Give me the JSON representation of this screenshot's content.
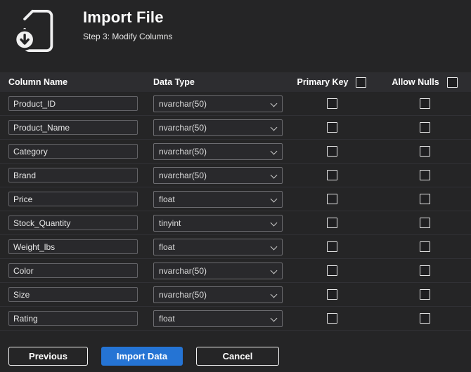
{
  "header": {
    "title": "Import File",
    "subtitle": "Step 3: Modify Columns",
    "icon": "file-download-icon"
  },
  "table": {
    "headers": {
      "column_name": "Column Name",
      "data_type": "Data Type",
      "primary_key": "Primary Key",
      "allow_nulls": "Allow Nulls"
    },
    "select_all": {
      "primary_key_checked": false,
      "allow_nulls_checked": false
    },
    "rows": [
      {
        "name": "Product_ID",
        "type": "nvarchar(50)",
        "primary_key": false,
        "allow_nulls": false
      },
      {
        "name": "Product_Name",
        "type": "nvarchar(50)",
        "primary_key": false,
        "allow_nulls": false
      },
      {
        "name": "Category",
        "type": "nvarchar(50)",
        "primary_key": false,
        "allow_nulls": false
      },
      {
        "name": "Brand",
        "type": "nvarchar(50)",
        "primary_key": false,
        "allow_nulls": false
      },
      {
        "name": "Price",
        "type": "float",
        "primary_key": false,
        "allow_nulls": false
      },
      {
        "name": "Stock_Quantity",
        "type": "tinyint",
        "primary_key": false,
        "allow_nulls": false
      },
      {
        "name": "Weight_lbs",
        "type": "float",
        "primary_key": false,
        "allow_nulls": false
      },
      {
        "name": "Color",
        "type": "nvarchar(50)",
        "primary_key": false,
        "allow_nulls": false
      },
      {
        "name": "Size",
        "type": "nvarchar(50)",
        "primary_key": false,
        "allow_nulls": false
      },
      {
        "name": "Rating",
        "type": "float",
        "primary_key": false,
        "allow_nulls": false
      }
    ]
  },
  "footer": {
    "previous": "Previous",
    "import": "Import Data",
    "cancel": "Cancel"
  },
  "colors": {
    "background": "#252526",
    "table_header_bg": "#2d2d30",
    "accent": "#2574d4",
    "text": "#ffffff"
  }
}
